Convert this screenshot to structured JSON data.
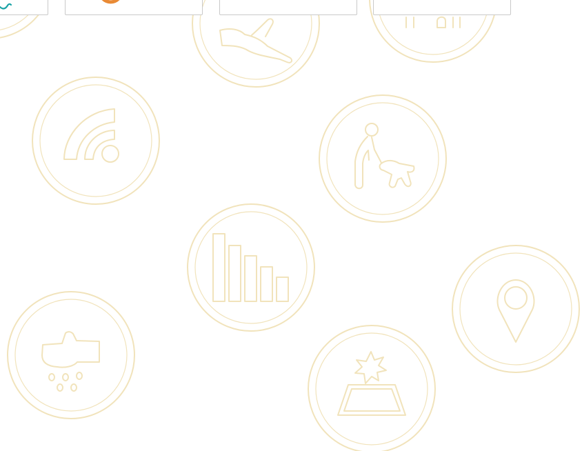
{
  "page": {
    "background": "#ffffff",
    "accent_stroke": "#f1e3bb",
    "card_border": "#c9c9c9",
    "brand_teal": "#1aa3a6",
    "brand_orange": "#e98a35"
  },
  "cards": [
    {
      "icon": "brand-logo-fragment"
    },
    {
      "icon": "orange-logo-fragment"
    },
    {
      "icon": "empty-card"
    },
    {
      "icon": "empty-card"
    }
  ],
  "badges": [
    {
      "icon": "hand-icon"
    },
    {
      "icon": "building-icon"
    },
    {
      "icon": "wifi-icon"
    },
    {
      "icon": "dog-walking-icon"
    },
    {
      "icon": "bar-chart-icon"
    },
    {
      "icon": "location-pin-icon"
    },
    {
      "icon": "cloud-rain-icon"
    },
    {
      "icon": "carpet-cleaning-icon"
    },
    {
      "icon": "circle-fragment-icon"
    }
  ]
}
